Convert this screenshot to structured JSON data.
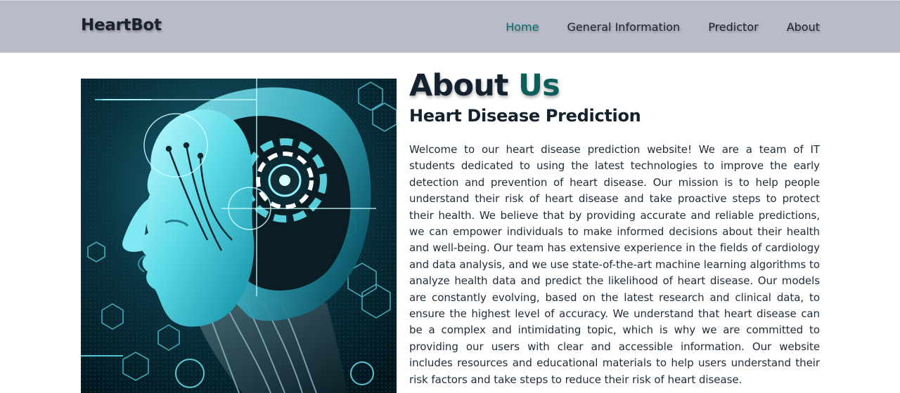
{
  "navbar": {
    "brand": "HeartBot",
    "links": [
      {
        "label": "Home",
        "active": true
      },
      {
        "label": "General Information",
        "active": false
      },
      {
        "label": "Predictor",
        "active": false
      },
      {
        "label": "About",
        "active": false
      }
    ]
  },
  "about": {
    "title_part1": "About ",
    "title_part2": "Us",
    "subtitle": "Heart Disease Prediction",
    "paragraph": "Welcome to our heart disease prediction website! We are a team of IT students dedicated to using the latest technologies to improve the early detection and prevention of heart disease. Our mission is to help people understand their risk of heart disease and take proactive steps to protect their health. We believe that by providing accurate and reliable predictions, we can empower individuals to make informed decisions about their health and well-being. Our team has extensive experience in the fields of cardiology and data analysis, and we use state-of-the-art machine learning algorithms to analyze health data and predict the likelihood of heart disease. Our models are constantly evolving, based on the latest research and clinical data, to ensure the highest level of accuracy. We understand that heart disease can be a complex and intimidating topic, which is why we are committed to providing our users with clear and accessible information. Our website includes resources and educational materials to help users understand their risk factors and take steps to reduce their risk of heart disease."
  },
  "colors": {
    "navbar_bg": "#b9bbc8",
    "accent": "#0b5e5a",
    "active_link": "#0b6e6a",
    "text": "#14212f"
  },
  "icons": {
    "hero": "ai-robot-head-image"
  }
}
